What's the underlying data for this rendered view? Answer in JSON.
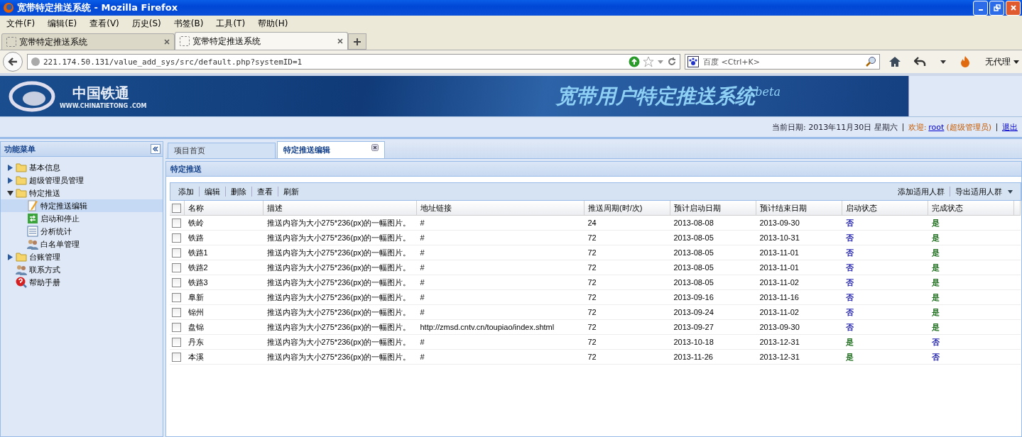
{
  "window": {
    "title": "宽带特定推送系统 - Mozilla Firefox"
  },
  "menu_bar": [
    "文件(F)",
    "编辑(E)",
    "查看(V)",
    "历史(S)",
    "书签(B)",
    "工具(T)",
    "帮助(H)"
  ],
  "browser_tabs": [
    {
      "label": "宽带特定推送系统",
      "selected": false
    },
    {
      "label": "宽带特定推送系统",
      "selected": true
    }
  ],
  "address_bar": {
    "value": "221.174.50.131/value_add_sys/src/default.php?systemID=1"
  },
  "search_bar": {
    "placeholder": "百度 <Ctrl+K>"
  },
  "proxy_button": "无代理",
  "banner": {
    "logo_cn": "中国铁通",
    "logo_url": "WWW.CHINATIETONG .COM",
    "title": "宽带用户特定推送系统",
    "title_sup": "beta"
  },
  "info_bar": {
    "date_text": "当前日期: 2013年11月30日 星期六",
    "welcome": "欢迎:",
    "user": "root",
    "role": "(超级管理员)",
    "logout": "退出"
  },
  "sidebar": {
    "title": "功能菜单",
    "items": [
      {
        "label": "基本信息",
        "kind": "folder",
        "expanded": false,
        "selected": false
      },
      {
        "label": "超级管理员管理",
        "kind": "folder",
        "expanded": false,
        "selected": false
      },
      {
        "label": "特定推送",
        "kind": "folder",
        "expanded": true,
        "selected": false,
        "children": [
          {
            "label": "特定推送编辑",
            "kind": "pencil",
            "selected": true
          },
          {
            "label": "启动和停止",
            "kind": "switch",
            "selected": false
          },
          {
            "label": "分析统计",
            "kind": "list",
            "selected": false
          },
          {
            "label": "白名单管理",
            "kind": "users",
            "selected": false
          }
        ]
      },
      {
        "label": "台账管理",
        "kind": "folder",
        "expanded": false,
        "selected": false
      },
      {
        "label": "联系方式",
        "kind": "users",
        "selected": false
      },
      {
        "label": "帮助手册",
        "kind": "help",
        "selected": false
      }
    ]
  },
  "content_tabs": [
    {
      "label": "项目首页",
      "selected": false,
      "closable": false
    },
    {
      "label": "特定推送编辑",
      "selected": true,
      "closable": true
    }
  ],
  "panel": {
    "title": "特定推送"
  },
  "toolbar": {
    "left": [
      "添加",
      "编辑",
      "删除",
      "查看",
      "刷新"
    ],
    "right": [
      "添加适用人群",
      "导出适用人群"
    ]
  },
  "table": {
    "all_checked": false,
    "columns": [
      "名称",
      "描述",
      "地址链接",
      "推送周期(时/次)",
      "预计启动日期",
      "预计结束日期",
      "启动状态",
      "完成状态"
    ],
    "rows": [
      {
        "checked": false,
        "cells": [
          "铁岭",
          "推送内容为大小275*236(px)的一幅图片。",
          "#",
          "24",
          "2013-08-08",
          "2013-09-30"
        ],
        "start_status": {
          "label": "否",
          "color": "#1c1caa"
        },
        "done_status": {
          "label": "是",
          "color": "#1e6e1e"
        }
      },
      {
        "checked": false,
        "cells": [
          "铁路",
          "推送内容为大小275*236(px)的一幅图片。",
          "#",
          "72",
          "2013-08-05",
          "2013-10-31"
        ],
        "start_status": {
          "label": "否",
          "color": "#1c1caa"
        },
        "done_status": {
          "label": "是",
          "color": "#1e6e1e"
        }
      },
      {
        "checked": false,
        "cells": [
          "铁路1",
          "推送内容为大小275*236(px)的一幅图片。",
          "#",
          "72",
          "2013-08-05",
          "2013-11-01"
        ],
        "start_status": {
          "label": "否",
          "color": "#1c1caa"
        },
        "done_status": {
          "label": "是",
          "color": "#1e6e1e"
        }
      },
      {
        "checked": false,
        "cells": [
          "铁路2",
          "推送内容为大小275*236(px)的一幅图片。",
          "#",
          "72",
          "2013-08-05",
          "2013-11-01"
        ],
        "start_status": {
          "label": "否",
          "color": "#1c1caa"
        },
        "done_status": {
          "label": "是",
          "color": "#1e6e1e"
        }
      },
      {
        "checked": false,
        "cells": [
          "铁路3",
          "推送内容为大小275*236(px)的一幅图片。",
          "#",
          "72",
          "2013-08-05",
          "2013-11-02"
        ],
        "start_status": {
          "label": "否",
          "color": "#1c1caa"
        },
        "done_status": {
          "label": "是",
          "color": "#1e6e1e"
        }
      },
      {
        "checked": false,
        "cells": [
          "阜新",
          "推送内容为大小275*236(px)的一幅图片。",
          "#",
          "72",
          "2013-09-16",
          "2013-11-16"
        ],
        "start_status": {
          "label": "否",
          "color": "#1c1caa"
        },
        "done_status": {
          "label": "是",
          "color": "#1e6e1e"
        }
      },
      {
        "checked": false,
        "cells": [
          "锦州",
          "推送内容为大小275*236(px)的一幅图片。",
          "#",
          "72",
          "2013-09-24",
          "2013-11-02"
        ],
        "start_status": {
          "label": "否",
          "color": "#1c1caa"
        },
        "done_status": {
          "label": "是",
          "color": "#1e6e1e"
        }
      },
      {
        "checked": false,
        "cells": [
          "盘锦",
          "推送内容为大小275*236(px)的一幅图片。",
          "http://zmsd.cntv.cn/toupiao/index.shtml",
          "72",
          "2013-09-27",
          "2013-09-30"
        ],
        "start_status": {
          "label": "否",
          "color": "#1c1caa"
        },
        "done_status": {
          "label": "是",
          "color": "#1e6e1e"
        }
      },
      {
        "checked": false,
        "cells": [
          "丹东",
          "推送内容为大小275*236(px)的一幅图片。",
          "#",
          "72",
          "2013-10-18",
          "2013-12-31"
        ],
        "start_status": {
          "label": "是",
          "color": "#1e6e1e"
        },
        "done_status": {
          "label": "否",
          "color": "#1c1caa"
        }
      },
      {
        "checked": false,
        "cells": [
          "本溪",
          "推送内容为大小275*236(px)的一幅图片。",
          "#",
          "72",
          "2013-11-26",
          "2013-12-31"
        ],
        "start_status": {
          "label": "是",
          "color": "#1e6e1e"
        },
        "done_status": {
          "label": "否",
          "color": "#1c1caa"
        }
      }
    ]
  }
}
